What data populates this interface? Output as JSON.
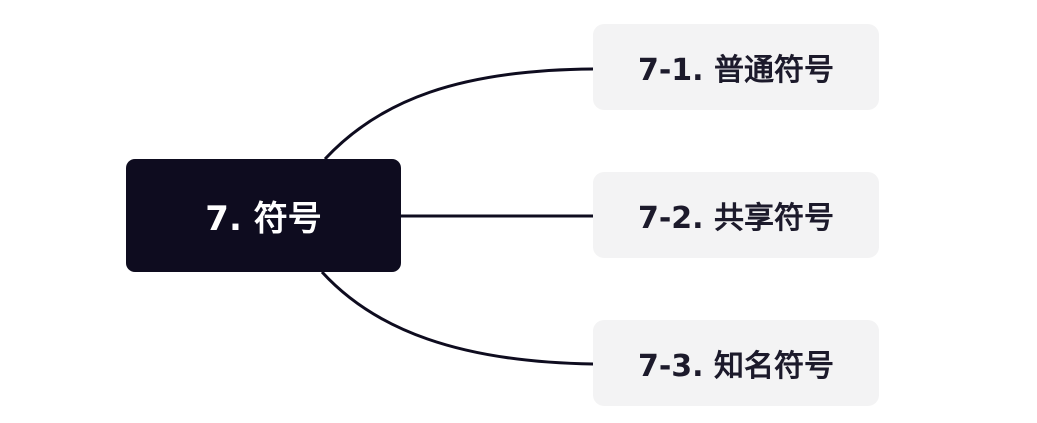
{
  "mindmap": {
    "root": {
      "label": "7. 符号"
    },
    "children": [
      {
        "label": "7-1. 普通符号"
      },
      {
        "label": "7-2. 共享符号"
      },
      {
        "label": "7-3. 知名符号"
      }
    ]
  },
  "colors": {
    "root_background": "#0e0c1f",
    "root_text": "#ffffff",
    "child_background": "#f3f3f4",
    "child_text": "#1c1a2b",
    "connector": "#0e0c1f"
  }
}
